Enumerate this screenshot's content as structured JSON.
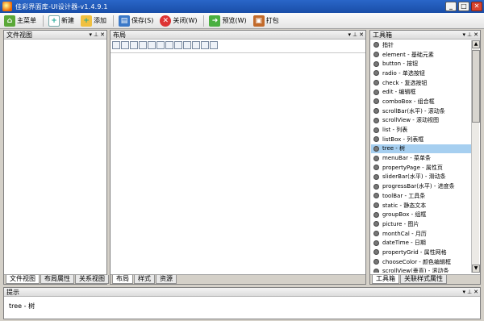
{
  "window": {
    "title": "佳彩界面库-UI设计器-v1.4.9.1",
    "controls": [
      "_",
      "□",
      "✕"
    ]
  },
  "toolbar": {
    "buttons": [
      {
        "label": "主菜单",
        "icon": "home-icon"
      },
      {
        "label": "新建",
        "icon": "new-icon"
      },
      {
        "label": "添加",
        "icon": "add-icon"
      },
      {
        "label": "保存(S)",
        "icon": "save-icon"
      },
      {
        "label": "关闭(W)",
        "icon": "close-icon"
      },
      {
        "label": "预览(W)",
        "icon": "preview-arrow-icon"
      },
      {
        "label": "打包",
        "icon": "package-icon"
      }
    ]
  },
  "file_panel": {
    "title": "文件视图",
    "tabs": [
      "文件视图",
      "布局属性",
      "关系视图"
    ]
  },
  "layout_panel": {
    "title": "布局",
    "tabs": [
      "布局",
      "样式",
      "资源"
    ]
  },
  "toolbox_panel": {
    "title": "工具箱",
    "items": [
      "指针",
      "element - 基础元素",
      "button - 按钮",
      "radio - 单选按钮",
      "check - 复选按钮",
      "edit - 编辑框",
      "comboBox - 组合框",
      "scrollBar(水平) - 滚动条",
      "scrollView - 滚动视图",
      "list - 列表",
      "listBox - 列表框",
      "tree - 树",
      "menuBar - 菜单条",
      "propertyPage - 属性页",
      "sliderBar(水平) - 滑动条",
      "progressBar(水平) - 进度条",
      "toolBar - 工具条",
      "static - 静态文本",
      "groupBox - 组框",
      "picture - 图片",
      "monthCal - 月历",
      "dateTime - 日期",
      "propertyGrid - 属性网格",
      "chooseColor - 颜色编辑框",
      "scrollView(垂直) - 滚动条"
    ],
    "selected_index": 11,
    "tabs": [
      "工具箱",
      "关联样式属性"
    ]
  },
  "hint_panel": {
    "title": "提示",
    "text": "tree - 树"
  },
  "colors": {
    "titlebar": "#1a4ea8",
    "selection": "#a6cff0"
  }
}
